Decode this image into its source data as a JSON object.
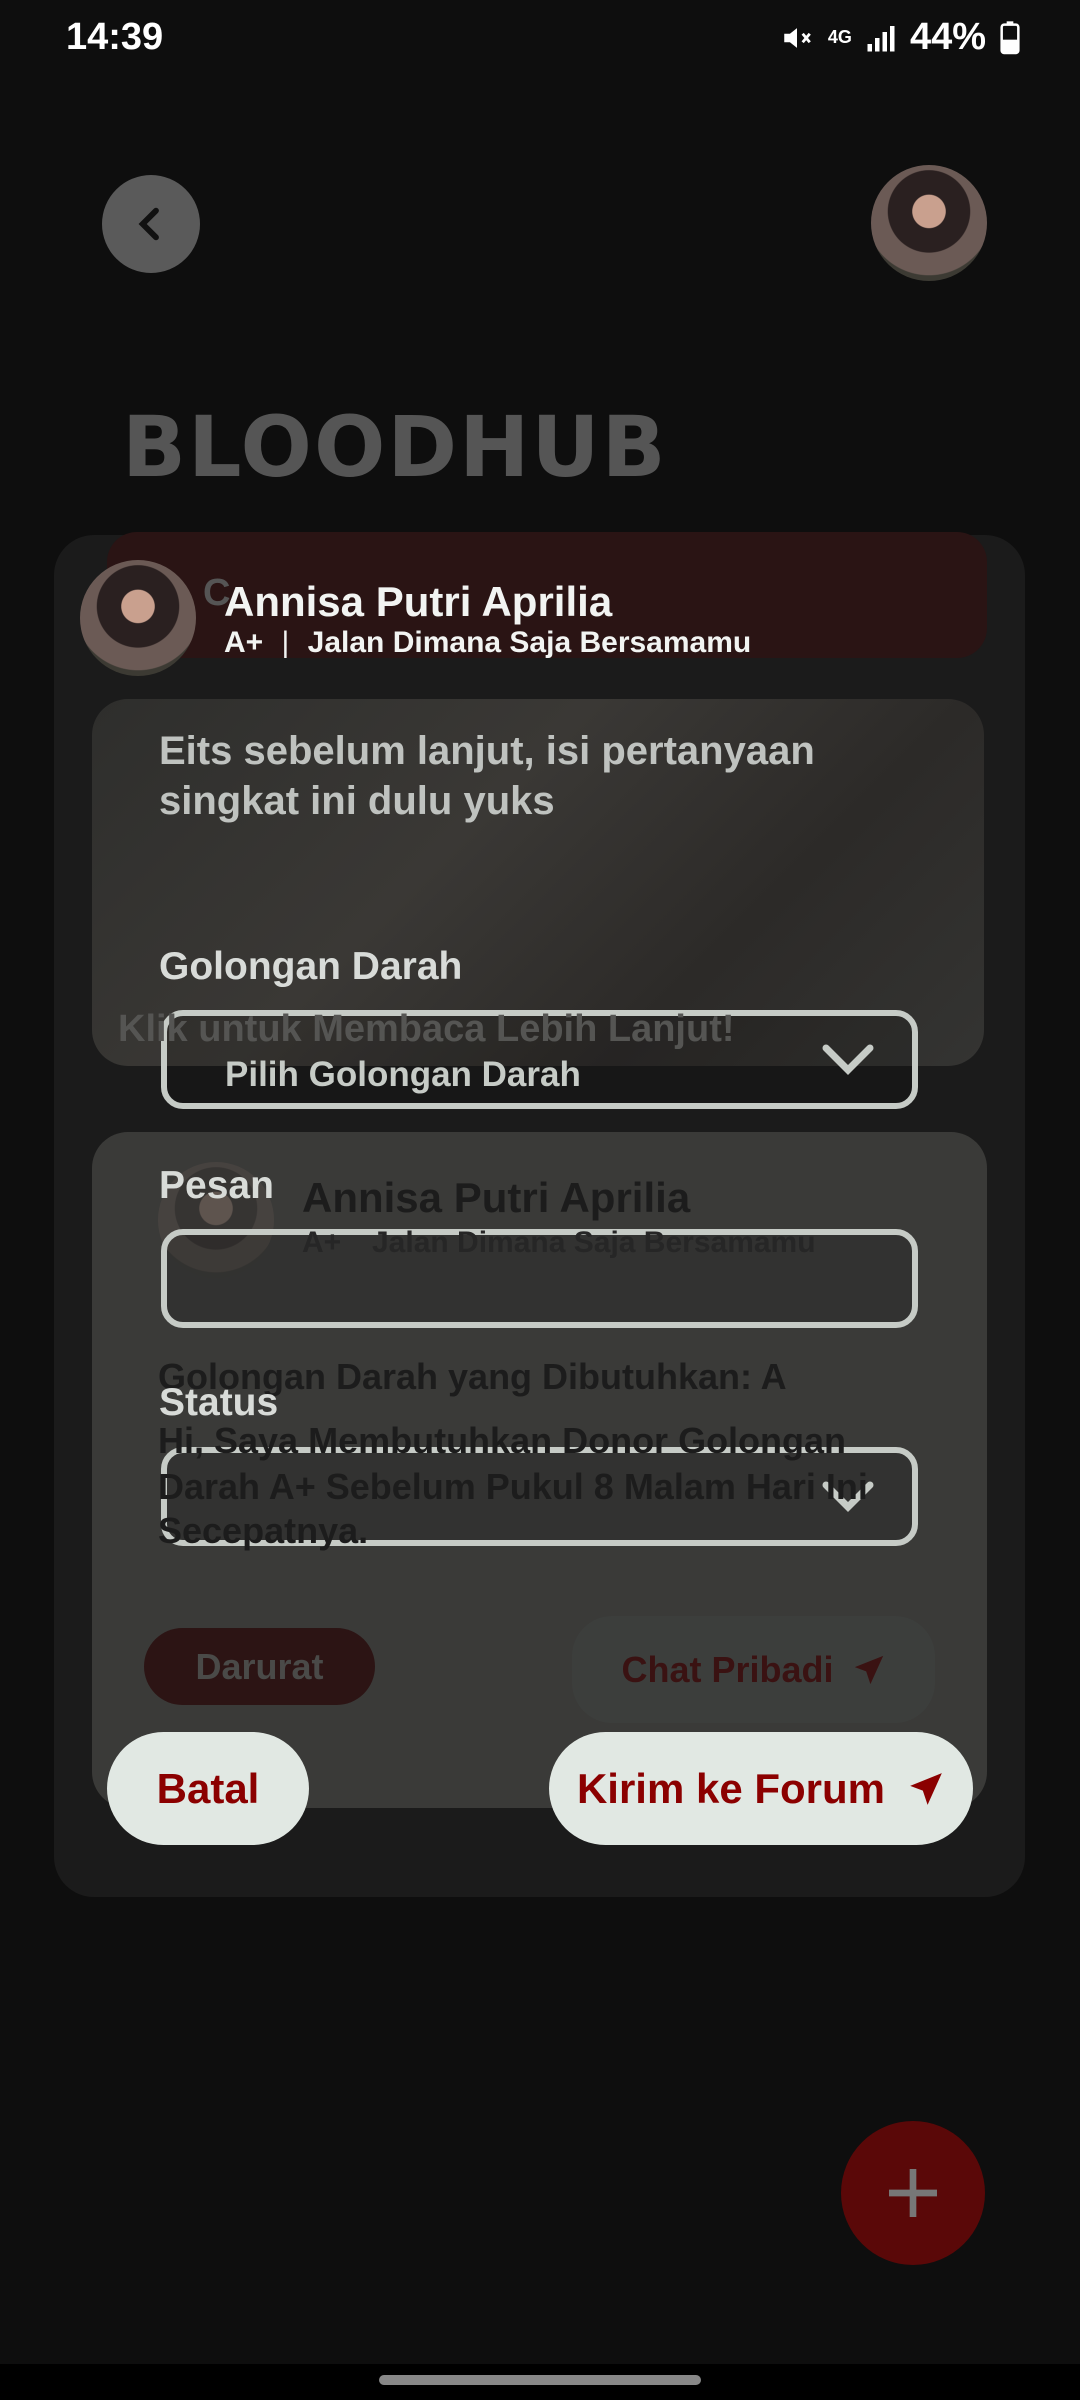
{
  "status_bar": {
    "time": "14:39",
    "network": "4G",
    "battery": "44%"
  },
  "header": {
    "brand": "BLOODHUB"
  },
  "background": {
    "card_partial_text": "C",
    "read_more": "Klik untuk Membaca Lebih Lanjut!",
    "post": {
      "name": "Annisa Putri Aprilia",
      "blood": "A+",
      "address": "Jalan Dimana Saja Bersamamu",
      "needed": "Golongan Darah yang Dibutuhkan: A",
      "message_lines": [
        "Hi, Saya Membutuhkan Donor Golongan",
        "Darah A+ Sebelum Pukul 8 Malam Hari Ini",
        "Secepatnya."
      ],
      "status_badge": "Darurat",
      "chat_button": "Chat Pribadi"
    }
  },
  "dialog": {
    "user": {
      "name": "Annisa Putri Aprilia",
      "blood": "A+",
      "separator": "|",
      "address": "Jalan Dimana Saja Bersamamu"
    },
    "intro": "Eits sebelum lanjut, isi pertanyaan singkat ini dulu yuks",
    "blood_label": "Golongan Darah",
    "blood_placeholder": "Pilih Golongan Darah",
    "message_label": "Pesan",
    "message_value": "",
    "status_label": "Status",
    "status_value": "",
    "cancel": "Batal",
    "submit": "Kirim ke Forum"
  },
  "colors": {
    "accent": "#8b0000",
    "button_bg": "#e1e8e3"
  }
}
